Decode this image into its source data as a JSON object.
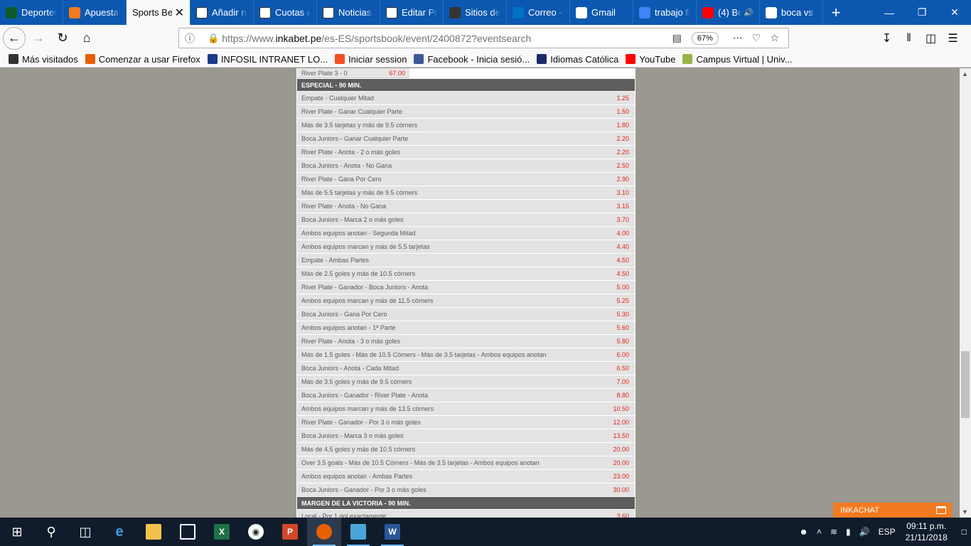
{
  "tabs": [
    {
      "label": "Deportes",
      "icon": "st-icon",
      "color": "#0d5c2b"
    },
    {
      "label": "Apuestas",
      "icon": "b-icon",
      "color": "#f47a20"
    },
    {
      "label": "Sports Be",
      "icon": "none",
      "color": "",
      "active": true
    },
    {
      "label": "Añadir n",
      "icon": "soccer-ball-icon",
      "color": "#ffffff"
    },
    {
      "label": "Cuotas e",
      "icon": "soccer-ball-icon",
      "color": "#ffffff"
    },
    {
      "label": "Noticias",
      "icon": "soccer-ball-icon",
      "color": "#ffffff"
    },
    {
      "label": "Editar Pr",
      "icon": "soccer-ball-icon",
      "color": "#ffffff"
    },
    {
      "label": "Sitios de",
      "icon": "globe-icon",
      "color": "#333333"
    },
    {
      "label": "Correo -",
      "icon": "outlook-icon",
      "color": "#0072c6"
    },
    {
      "label": "Gmail",
      "icon": "gmail-icon",
      "color": "#ffffff"
    },
    {
      "label": "trabajo fi",
      "icon": "docs-icon",
      "color": "#4285f4"
    },
    {
      "label": "(4) Be",
      "icon": "youtube-icon",
      "color": "#ff0000",
      "audio": true
    },
    {
      "label": "boca vs",
      "icon": "google-icon",
      "color": "#ffffff"
    }
  ],
  "nav": {
    "url_prefix": "https://www.",
    "url_domain": "inkabet.pe",
    "url_rest": "/es-ES/sportsbook/event/2400872?eventsearch",
    "zoom": "67%"
  },
  "bookmarks": [
    {
      "label": "Más visitados",
      "icon": "gear-icon",
      "color": "#333333"
    },
    {
      "label": "Comenzar a usar Firefox",
      "icon": "firefox-icon",
      "color": "#e66000"
    },
    {
      "label": "INFOSIL INTRANET LO...",
      "icon": "infosil-icon",
      "color": "#1a3a8a"
    },
    {
      "label": "Iniciar session",
      "icon": "windows-icon",
      "color": "#f25022"
    },
    {
      "label": "Facebook - Inicia sesió...",
      "icon": "facebook-icon",
      "color": "#3b5998"
    },
    {
      "label": "Idiomas Católica",
      "icon": "catolica-icon",
      "color": "#1a2a6a"
    },
    {
      "label": "YouTube",
      "icon": "youtube-icon",
      "color": "#ff0000"
    },
    {
      "label": "Campus Virtual | Univ...",
      "icon": "campus-icon",
      "color": "#9ab34a"
    }
  ],
  "top_row": {
    "label": "River Plate 3 - 0",
    "odd": "67.00"
  },
  "sections": [
    {
      "title": "ESPECIAL - 90 MIN.",
      "rows": [
        {
          "label": "Empate - Cualquier Mitad",
          "odd": "1.25"
        },
        {
          "label": "River Plate - Ganar Cualquier Parte",
          "odd": "1.50"
        },
        {
          "label": "Más de 3.5 tarjetas y más de 9.5 córners",
          "odd": "1.80"
        },
        {
          "label": "Boca Juniors - Ganar Cualquier Parte",
          "odd": "2.20"
        },
        {
          "label": "River Plate - Anota - 2 o más goles",
          "odd": "2.20"
        },
        {
          "label": "Boca Juniors - Anota - No Gana",
          "odd": "2.50"
        },
        {
          "label": "River Plate - Gana Por Cero",
          "odd": "2.90"
        },
        {
          "label": "Más de 5.5 tarjetas y más de 9.5 córners",
          "odd": "3.10"
        },
        {
          "label": "River Plate - Anota - No Gana",
          "odd": "3.15"
        },
        {
          "label": "Boca Juniors - Marca 2 o más goles",
          "odd": "3.70"
        },
        {
          "label": "Ambos equipos anotan - Segunda Mitad",
          "odd": "4.00"
        },
        {
          "label": "Ambos equipos marcan y más de 5.5 tarjetas",
          "odd": "4.40"
        },
        {
          "label": "Empate - Ambas Partes",
          "odd": "4.50"
        },
        {
          "label": "Más de 2.5 goles y más de 10.5 córners",
          "odd": "4.50"
        },
        {
          "label": "River Plate - Ganador - Boca Juniors - Anota",
          "odd": "5.00"
        },
        {
          "label": "Ambos equipos marcan y más de 11.5 córners",
          "odd": "5.25"
        },
        {
          "label": "Boca Juniors - Gana Por Cero",
          "odd": "5.30"
        },
        {
          "label": "Ambos equipos anotan - 1ª Parte",
          "odd": "5.60"
        },
        {
          "label": "River Plate - Anota - 3 o más goles",
          "odd": "5.80"
        },
        {
          "label": "Más de 1.5 goles - Más de 10.5 Córners - Más de 3.5 tarjetas - Ambos equipos anotan",
          "odd": "6.00"
        },
        {
          "label": "Boca Juniors - Anota - Cada Mitad",
          "odd": "6.50"
        },
        {
          "label": "Más de 3.5 goles y más de 9.5 córners",
          "odd": "7.00"
        },
        {
          "label": "Boca Juniors - Ganador - River Plate - Anota",
          "odd": "8.80"
        },
        {
          "label": "Ambos equipos marcan y más de 13.5 córners",
          "odd": "10.50"
        },
        {
          "label": "River Plate - Ganador - Por 3 o más goles",
          "odd": "12.00"
        },
        {
          "label": "Boca Juniors - Marca 3 o más goles",
          "odd": "13.50"
        },
        {
          "label": "Más de 4.5 goles y más de 10.5 córners",
          "odd": "20.00"
        },
        {
          "label": "Over 3.5 goals - Más de 10.5 Córners - Más de 3.5 tarjetas - Ambos equipos anotan",
          "odd": "20.00"
        },
        {
          "label": "Ambos equipos anotan - Ambas Partes",
          "odd": "23.00"
        },
        {
          "label": "Boca Juniors - Ganador - Por 3 o más goles",
          "odd": "30.00"
        }
      ]
    },
    {
      "title": "MARGEN DE LA VICTORIA - 90 MIN.",
      "rows": [
        {
          "label": "Local - Por 1 gol exactamente",
          "odd": "3.60"
        }
      ]
    }
  ],
  "chat": {
    "label": "INKACHAT"
  },
  "taskbar": {
    "language": "ESP",
    "time": "09:11 p.m.",
    "date": "21/11/2018"
  }
}
